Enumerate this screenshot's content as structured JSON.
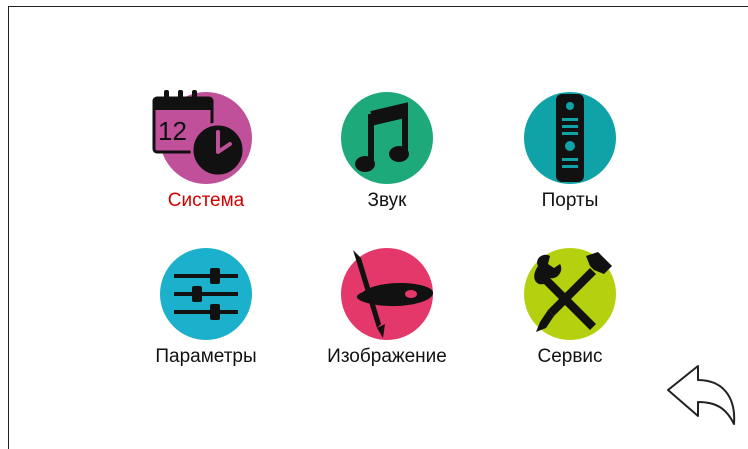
{
  "menu": {
    "items": [
      {
        "label": "Система",
        "icon": "calendar-clock-icon",
        "color": "#c0509a",
        "active": true
      },
      {
        "label": "Звук",
        "icon": "music-note-icon",
        "color": "#1ea97a",
        "active": false
      },
      {
        "label": "Порты",
        "icon": "intercom-panel-icon",
        "color": "#0fa3a8",
        "active": false
      },
      {
        "label": "Параметры",
        "icon": "sliders-icon",
        "color": "#1bb0cc",
        "active": false
      },
      {
        "label": "Изображение",
        "icon": "palette-brush-icon",
        "color": "#e4386a",
        "active": false
      },
      {
        "label": "Сервис",
        "icon": "wrench-screwdriver-icon",
        "color": "#b5d00e",
        "active": false
      }
    ]
  },
  "calendar_number": "12",
  "back": {
    "icon": "back-arrow-icon"
  }
}
